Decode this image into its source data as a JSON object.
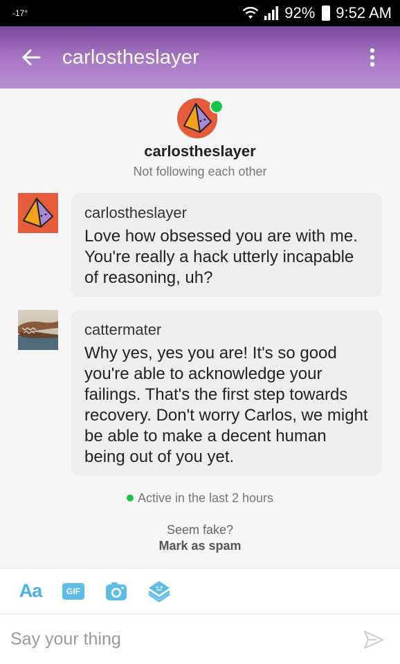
{
  "status_bar": {
    "temperature": "-17°",
    "battery": "92%",
    "time": "9:52 AM"
  },
  "app_bar": {
    "title": "carlostheslayer"
  },
  "profile": {
    "name": "carlostheslayer",
    "relationship": "Not following each other"
  },
  "messages": [
    {
      "sender": "carlostheslayer",
      "text": "Love how obsessed you are with me. You're really a hack utterly incapable of reasoning, uh?"
    },
    {
      "sender": "cattermater",
      "text": "Why yes, yes you are! It's so good you're able to acknowledge your failings. That's the first step towards recovery. Don't worry Carlos, we might be able to make a decent human being out of you yet."
    }
  ],
  "activity": {
    "text": "Active in the last 2 hours"
  },
  "spam": {
    "prompt": "Seem fake?",
    "action": "Mark as spam"
  },
  "toolbar": {
    "text_style_label": "Aa",
    "gif_label": "GIF"
  },
  "composer": {
    "placeholder": "Say your thing"
  },
  "colors": {
    "accent": "#7b4a9c",
    "online": "#13c845",
    "tool_blue": "#4ab0e8",
    "avatar_orange": "#e45c3a"
  }
}
